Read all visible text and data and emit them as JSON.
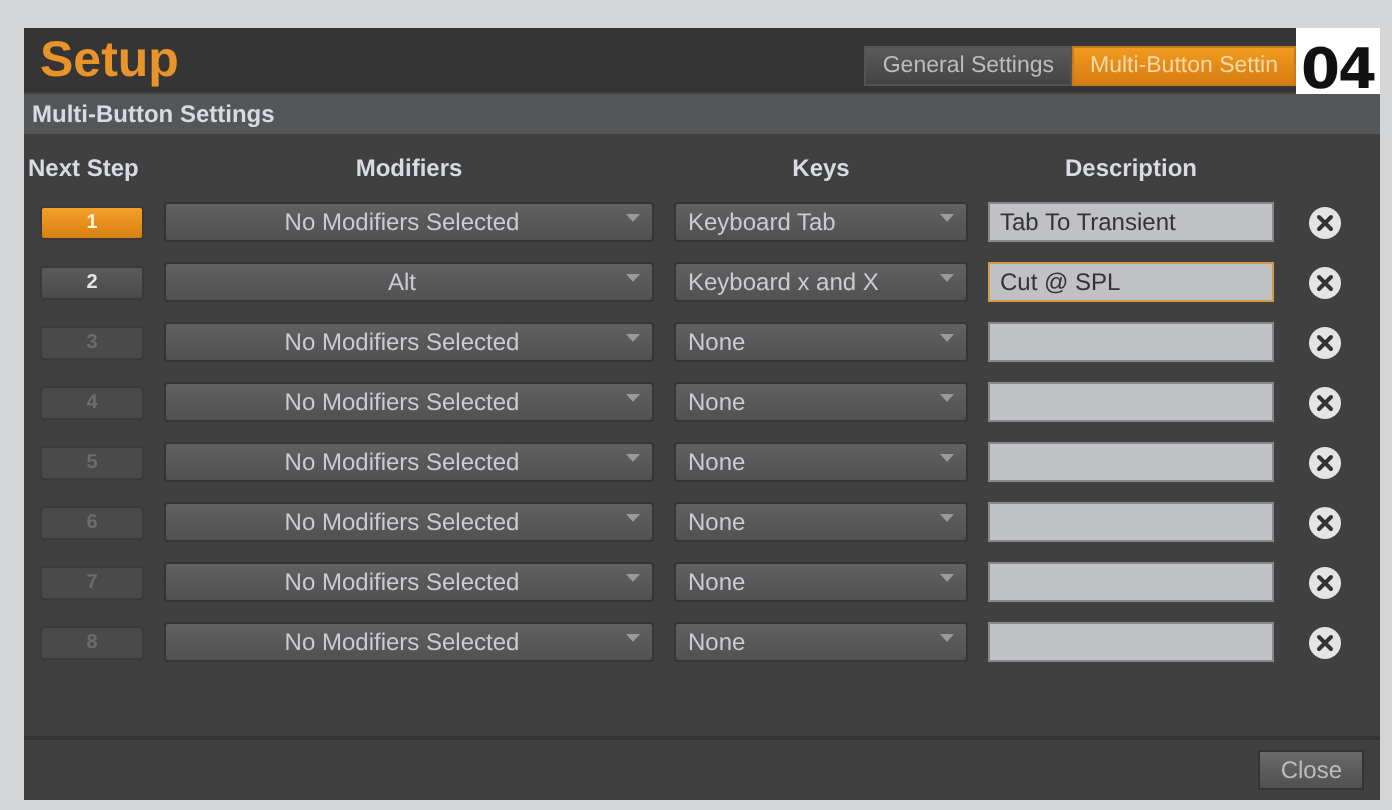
{
  "window": {
    "title": "Setup"
  },
  "tabs": [
    {
      "label": "General Settings",
      "selected": false
    },
    {
      "label": "Multi-Button Settin",
      "selected": true
    }
  ],
  "badge": "04",
  "section_title": "Multi-Button Settings",
  "columns": [
    "Next Step",
    "Modifiers",
    "Keys",
    "Description"
  ],
  "rows": [
    {
      "step": "1",
      "selected": true,
      "disabled": false,
      "modifiers": "No Modifiers Selected",
      "keys": "Keyboard Tab",
      "description": "Tab To Transient",
      "focused": false
    },
    {
      "step": "2",
      "selected": false,
      "disabled": false,
      "modifiers": "Alt",
      "keys": "Keyboard x and X",
      "description": "Cut @ SPL",
      "focused": true
    },
    {
      "step": "3",
      "selected": false,
      "disabled": true,
      "modifiers": "No Modifiers Selected",
      "keys": "None",
      "description": "",
      "focused": false
    },
    {
      "step": "4",
      "selected": false,
      "disabled": true,
      "modifiers": "No Modifiers Selected",
      "keys": "None",
      "description": "",
      "focused": false
    },
    {
      "step": "5",
      "selected": false,
      "disabled": true,
      "modifiers": "No Modifiers Selected",
      "keys": "None",
      "description": "",
      "focused": false
    },
    {
      "step": "6",
      "selected": false,
      "disabled": true,
      "modifiers": "No Modifiers Selected",
      "keys": "None",
      "description": "",
      "focused": false
    },
    {
      "step": "7",
      "selected": false,
      "disabled": true,
      "modifiers": "No Modifiers Selected",
      "keys": "None",
      "description": "",
      "focused": false
    },
    {
      "step": "8",
      "selected": false,
      "disabled": true,
      "modifiers": "No Modifiers Selected",
      "keys": "None",
      "description": "",
      "focused": false
    }
  ],
  "close_button": "Close"
}
